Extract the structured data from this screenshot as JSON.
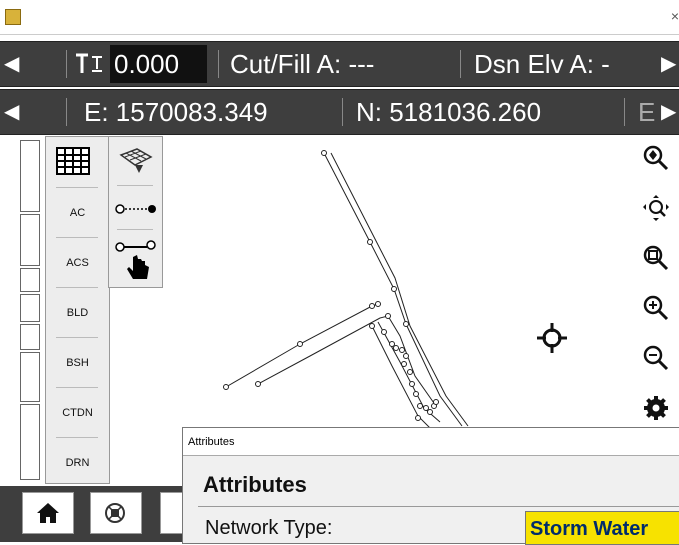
{
  "window": {
    "close_glyph": "×"
  },
  "status_bar_1": {
    "left_arrow": "◀",
    "icon": "elevation-icon",
    "elevation_value": "0.000",
    "cut_fill": "Cut/Fill A: ---",
    "dsn_elv": "Dsn Elv A: -",
    "right_arrow": "▶"
  },
  "status_bar_2": {
    "left_arrow": "◀",
    "easting": "E: 1570083.349",
    "northing": "N: 5181036.260",
    "trailing": "E",
    "right_arrow": "▶"
  },
  "layers": {
    "items": [
      "AC",
      "ACS",
      "BLD",
      "BSH",
      "CTDN",
      "DRN"
    ]
  },
  "tools": {
    "grid_icon": "grid-table-icon",
    "survey_icon": "survey-grid-icon",
    "line_icon": "point-line-icon",
    "select_icon": "hand-select-icon"
  },
  "map": {
    "crosshair_icon": "crosshair-target-icon"
  },
  "right_tools": [
    "zoom-to-point-icon",
    "pan-icon",
    "zoom-extents-icon",
    "zoom-in-icon",
    "zoom-out-icon",
    "settings-gear-icon"
  ],
  "bottom_bar": [
    "home-icon",
    "satellite-icon"
  ],
  "dialog": {
    "title": "Attributes",
    "heading": "Attributes",
    "field_label": "Network Type:",
    "field_value": "Storm Water"
  },
  "colors": {
    "bar_bg": "#3e3e3e",
    "highlight": "#f7e200",
    "value_text": "#002b6b"
  }
}
